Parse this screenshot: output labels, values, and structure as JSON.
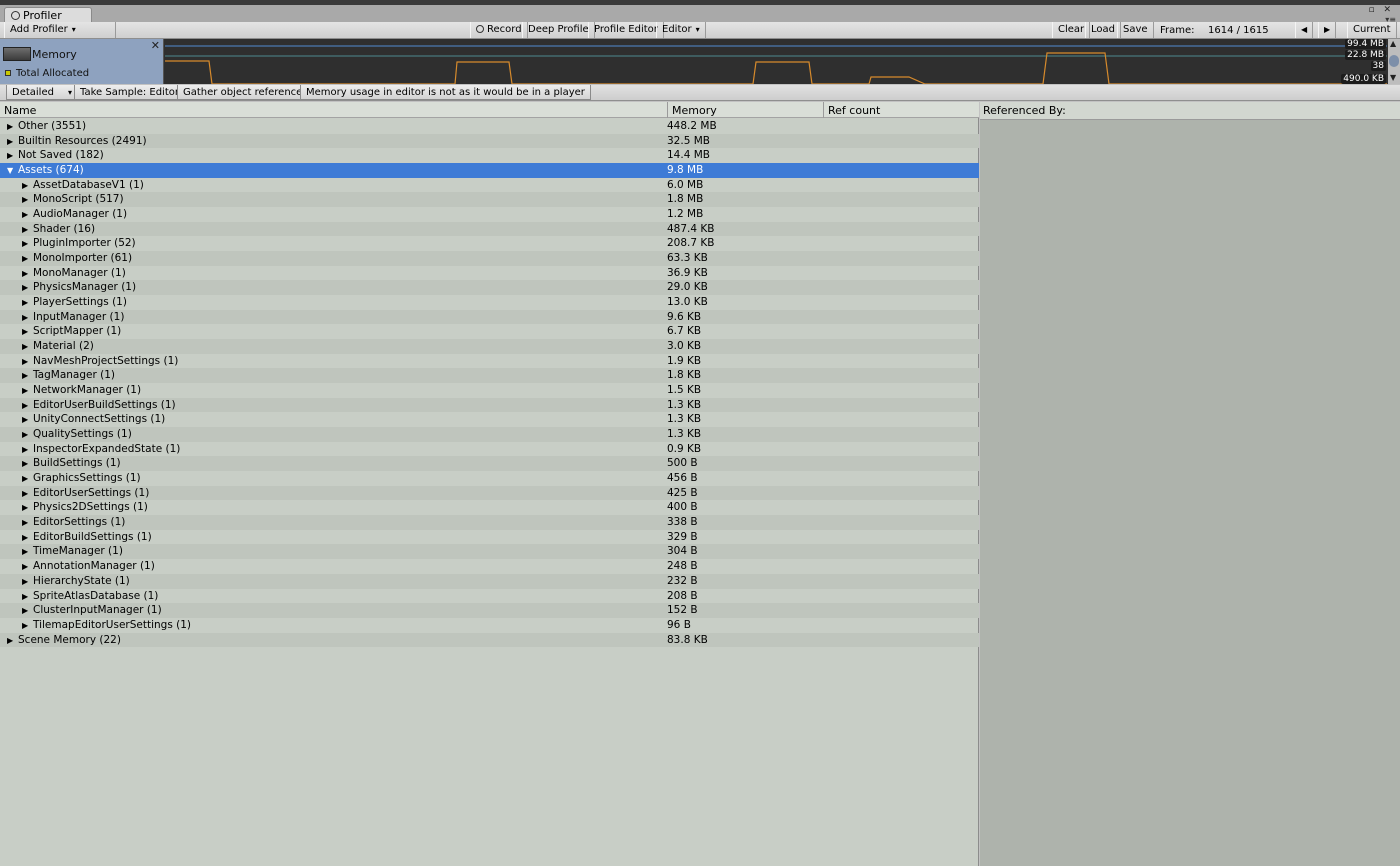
{
  "window": {
    "tab_label": "Profiler",
    "controls": "▫ ✕",
    "menu_glyph": "▾≡"
  },
  "toolbar": {
    "add_profiler": "Add Profiler",
    "record": "Record",
    "deep_profile": "Deep Profile",
    "profile_editor": "Profile Editor",
    "editor": "Editor",
    "clear": "Clear",
    "load": "Load",
    "save": "Save",
    "frame_label": "Frame:",
    "frame_value": "1614 / 1615",
    "prev_glyph": "◀",
    "next_glyph": "▶",
    "current": "Current"
  },
  "graph": {
    "module_title": "Memory",
    "close_glyph": "✕",
    "legend_label": "Total Allocated",
    "scales": [
      "99.4 MB",
      "22.8 MB",
      "38",
      "490.0 KB"
    ],
    "colors": {
      "module_bg": "#8ea2bf",
      "graph_bg": "#2f2f2f",
      "line": "#d68a2c",
      "legend": "#c8c800"
    }
  },
  "detail_toolbar": {
    "mode": "Detailed",
    "take_sample": "Take Sample: Editor",
    "gather": "Gather object references",
    "notice": "Memory usage in editor is not as it would be in a player"
  },
  "columns": {
    "name": "Name",
    "memory": "Memory",
    "ref_count": "Ref count"
  },
  "right_pane": {
    "title": "Referenced By:"
  },
  "tree": [
    {
      "name": "Other (3551)",
      "memory": "448.2 MB",
      "level": 0,
      "expanded": false
    },
    {
      "name": "Builtin Resources (2491)",
      "memory": "32.5 MB",
      "level": 0,
      "expanded": false
    },
    {
      "name": "Not Saved (182)",
      "memory": "14.4 MB",
      "level": 0,
      "expanded": false
    },
    {
      "name": "Assets (674)",
      "memory": "9.8 MB",
      "level": 0,
      "expanded": true,
      "selected": true
    },
    {
      "name": "AssetDatabaseV1 (1)",
      "memory": "6.0 MB",
      "level": 1
    },
    {
      "name": "MonoScript (517)",
      "memory": "1.8 MB",
      "level": 1
    },
    {
      "name": "AudioManager (1)",
      "memory": "1.2 MB",
      "level": 1
    },
    {
      "name": "Shader (16)",
      "memory": "487.4 KB",
      "level": 1
    },
    {
      "name": "PluginImporter (52)",
      "memory": "208.7 KB",
      "level": 1
    },
    {
      "name": "MonoImporter (61)",
      "memory": "63.3 KB",
      "level": 1
    },
    {
      "name": "MonoManager (1)",
      "memory": "36.9 KB",
      "level": 1
    },
    {
      "name": "PhysicsManager (1)",
      "memory": "29.0 KB",
      "level": 1
    },
    {
      "name": "PlayerSettings (1)",
      "memory": "13.0 KB",
      "level": 1
    },
    {
      "name": "InputManager (1)",
      "memory": "9.6 KB",
      "level": 1
    },
    {
      "name": "ScriptMapper (1)",
      "memory": "6.7 KB",
      "level": 1
    },
    {
      "name": "Material (2)",
      "memory": "3.0 KB",
      "level": 1
    },
    {
      "name": "NavMeshProjectSettings (1)",
      "memory": "1.9 KB",
      "level": 1
    },
    {
      "name": "TagManager (1)",
      "memory": "1.8 KB",
      "level": 1
    },
    {
      "name": "NetworkManager (1)",
      "memory": "1.5 KB",
      "level": 1
    },
    {
      "name": "EditorUserBuildSettings (1)",
      "memory": "1.3 KB",
      "level": 1
    },
    {
      "name": "UnityConnectSettings (1)",
      "memory": "1.3 KB",
      "level": 1
    },
    {
      "name": "QualitySettings (1)",
      "memory": "1.3 KB",
      "level": 1
    },
    {
      "name": "InspectorExpandedState (1)",
      "memory": "0.9 KB",
      "level": 1
    },
    {
      "name": "BuildSettings (1)",
      "memory": "500 B",
      "level": 1
    },
    {
      "name": "GraphicsSettings (1)",
      "memory": "456 B",
      "level": 1
    },
    {
      "name": "EditorUserSettings (1)",
      "memory": "425 B",
      "level": 1
    },
    {
      "name": "Physics2DSettings (1)",
      "memory": "400 B",
      "level": 1
    },
    {
      "name": "EditorSettings (1)",
      "memory": "338 B",
      "level": 1
    },
    {
      "name": "EditorBuildSettings (1)",
      "memory": "329 B",
      "level": 1
    },
    {
      "name": "TimeManager (1)",
      "memory": "304 B",
      "level": 1
    },
    {
      "name": "AnnotationManager (1)",
      "memory": "248 B",
      "level": 1
    },
    {
      "name": "HierarchyState (1)",
      "memory": "232 B",
      "level": 1
    },
    {
      "name": "SpriteAtlasDatabase (1)",
      "memory": "208 B",
      "level": 1
    },
    {
      "name": "ClusterInputManager (1)",
      "memory": "152 B",
      "level": 1
    },
    {
      "name": "TilemapEditorUserSettings (1)",
      "memory": "96 B",
      "level": 1
    },
    {
      "name": "Scene Memory (22)",
      "memory": "83.8 KB",
      "level": 0,
      "expanded": false
    }
  ]
}
